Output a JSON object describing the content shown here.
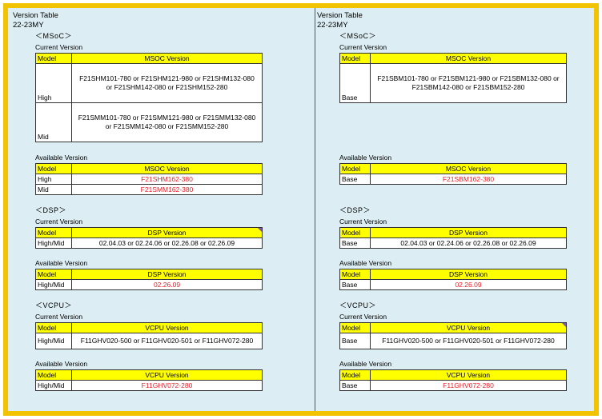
{
  "left": {
    "title": "Version Table",
    "subtitle": "22-23MY",
    "msoc": {
      "heading": "＜MSoC＞",
      "current_label": "Current Version",
      "available_label": "Available Version",
      "col_model": "Model",
      "col_version": "MSOC Version",
      "current_rows": [
        {
          "model": "High",
          "version": "F21SHM101-780 or F21SHM121-980 or F21SHM132-080\nor F21SHM142-080 or F21SHM152-280"
        },
        {
          "model": "Mid",
          "version": "F21SMM101-780 or F21SMM121-980 or F21SMM132-080\nor F21SMM142-080 or F21SMM152-280"
        }
      ],
      "available_rows": [
        {
          "model": "High",
          "version": "F21SHM162-380"
        },
        {
          "model": "Mid",
          "version": "F21SMM162-380"
        }
      ]
    },
    "dsp": {
      "heading": "＜DSP＞",
      "current_label": "Current Version",
      "available_label": "Available Version",
      "col_model": "Model",
      "col_version": "DSP Version",
      "current_rows": [
        {
          "model": "High/Mid",
          "version": "02.04.03 or 02.24.06 or 02.26.08 or 02.26.09"
        }
      ],
      "available_rows": [
        {
          "model": "High/Mid",
          "version": "02.26.09"
        }
      ]
    },
    "vcpu": {
      "heading": "＜VCPU＞",
      "current_label": "Current Version",
      "available_label": "Available Version",
      "col_model": "Model",
      "col_version": "VCPU Version",
      "current_rows": [
        {
          "model": "High/Mid",
          "version": "F11GHV020-500 or F11GHV020-501 or F11GHV072-280"
        }
      ],
      "available_rows": [
        {
          "model": "High/Mid",
          "version": "F11GHV072-280"
        }
      ]
    }
  },
  "right": {
    "title": "Version Table",
    "subtitle": "22-23MY",
    "msoc": {
      "heading": "＜MSoC＞",
      "current_label": "Current Version",
      "available_label": "Available Version",
      "col_model": "Model",
      "col_version": "MSOC Version",
      "current_rows": [
        {
          "model": "Base",
          "version": "F21SBM101-780 or F21SBM121-980 or F21SBM132-080 or\nF21SBM142-080 or F21SBM152-280"
        }
      ],
      "available_rows": [
        {
          "model": "Base",
          "version": "F21SBM162-380"
        }
      ]
    },
    "dsp": {
      "heading": "＜DSP＞",
      "current_label": "Current Version",
      "available_label": "Available Version",
      "col_model": "Model",
      "col_version": "DSP Version",
      "current_rows": [
        {
          "model": "Base",
          "version": "02.04.03 or 02.24.06 or 02.26.08 or 02.26.09"
        }
      ],
      "available_rows": [
        {
          "model": "Base",
          "version": "02.26.09"
        }
      ]
    },
    "vcpu": {
      "heading": "＜VCPU＞",
      "current_label": "Current Version",
      "available_label": "Available Version",
      "col_model": "Model",
      "col_version": "VCPU Version",
      "current_rows": [
        {
          "model": "Base",
          "version": "F11GHV020-500  or F11GHV020-501 or F11GHV072-280"
        }
      ],
      "available_rows": [
        {
          "model": "Base",
          "version": "F11GHV072-280"
        }
      ]
    }
  }
}
